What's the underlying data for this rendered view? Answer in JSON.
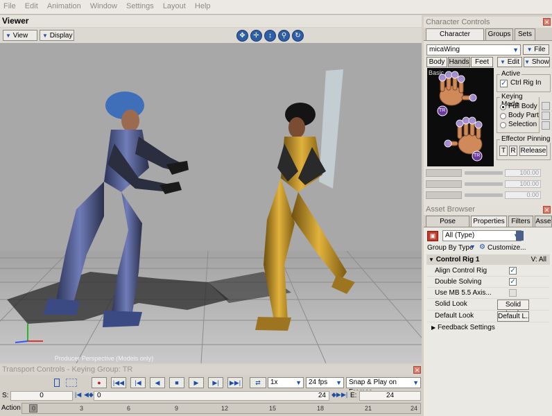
{
  "menu": [
    "File",
    "Edit",
    "Animation",
    "Window",
    "Settings",
    "Layout",
    "Help"
  ],
  "viewer": {
    "title": "Viewer",
    "view_btn": "View",
    "display_btn": "Display",
    "nav_icons": [
      "pan-icon",
      "move-icon",
      "dolly-icon",
      "zoom-icon",
      "orbit-icon"
    ],
    "caption": "Producer Perspective (Models only)"
  },
  "transport": {
    "title": "Transport Controls  -  Keying Group: TR",
    "speed": "1x",
    "fps": "24 fps",
    "snap": "Snap & Play on Frames",
    "start_label": "S:",
    "start_value": "0",
    "current_value": "0",
    "current_end": "24",
    "end_label": "E:",
    "end_value": "24",
    "action_label": "Action",
    "ruler_ticks": [
      "0",
      "3",
      "6",
      "9",
      "12",
      "15",
      "18",
      "21",
      "24"
    ]
  },
  "character_controls": {
    "title": "Character Controls",
    "tabs": [
      "Character Controls",
      "Groups",
      "Sets"
    ],
    "character": "micaWing",
    "file_btn": "File",
    "subtabs": [
      "Body",
      "Hands",
      "Feet"
    ],
    "edit_btn": "Edit",
    "show_btn": "Show",
    "hands_label": "Basic",
    "active_group": "Active",
    "ctrl_rig": "Ctrl Rig In",
    "keying_group": "Keying Mode",
    "keying_options": [
      "Full Body",
      "Body Part",
      "Selection"
    ],
    "pinning_group": "Effector Pinning",
    "pin_t": "T",
    "pin_r": "R",
    "release": "Release",
    "tr_badge": "TR",
    "slider_values": [
      "100.00",
      "100.00",
      "0.00"
    ]
  },
  "asset_browser": {
    "title": "Asset Browser",
    "tabs": [
      "Pose Controls",
      "Properties",
      "Filters",
      "Asse"
    ],
    "type_filter": "All (Type)",
    "group_by": "Group By Type",
    "customize": "Customize...",
    "section": "Control Rig 1",
    "section_right": "V: All",
    "props": [
      {
        "label": "Align Control Rig",
        "checked": true
      },
      {
        "label": "Double Solving",
        "checked": true
      },
      {
        "label": "Use MB 5.5 Axis...",
        "checked": false
      }
    ],
    "solid_label": "Solid Look",
    "solid_btn": "Solid Look",
    "default_label": "Default Look",
    "default_btn": "Default L...",
    "feedback": "Feedback Settings"
  }
}
